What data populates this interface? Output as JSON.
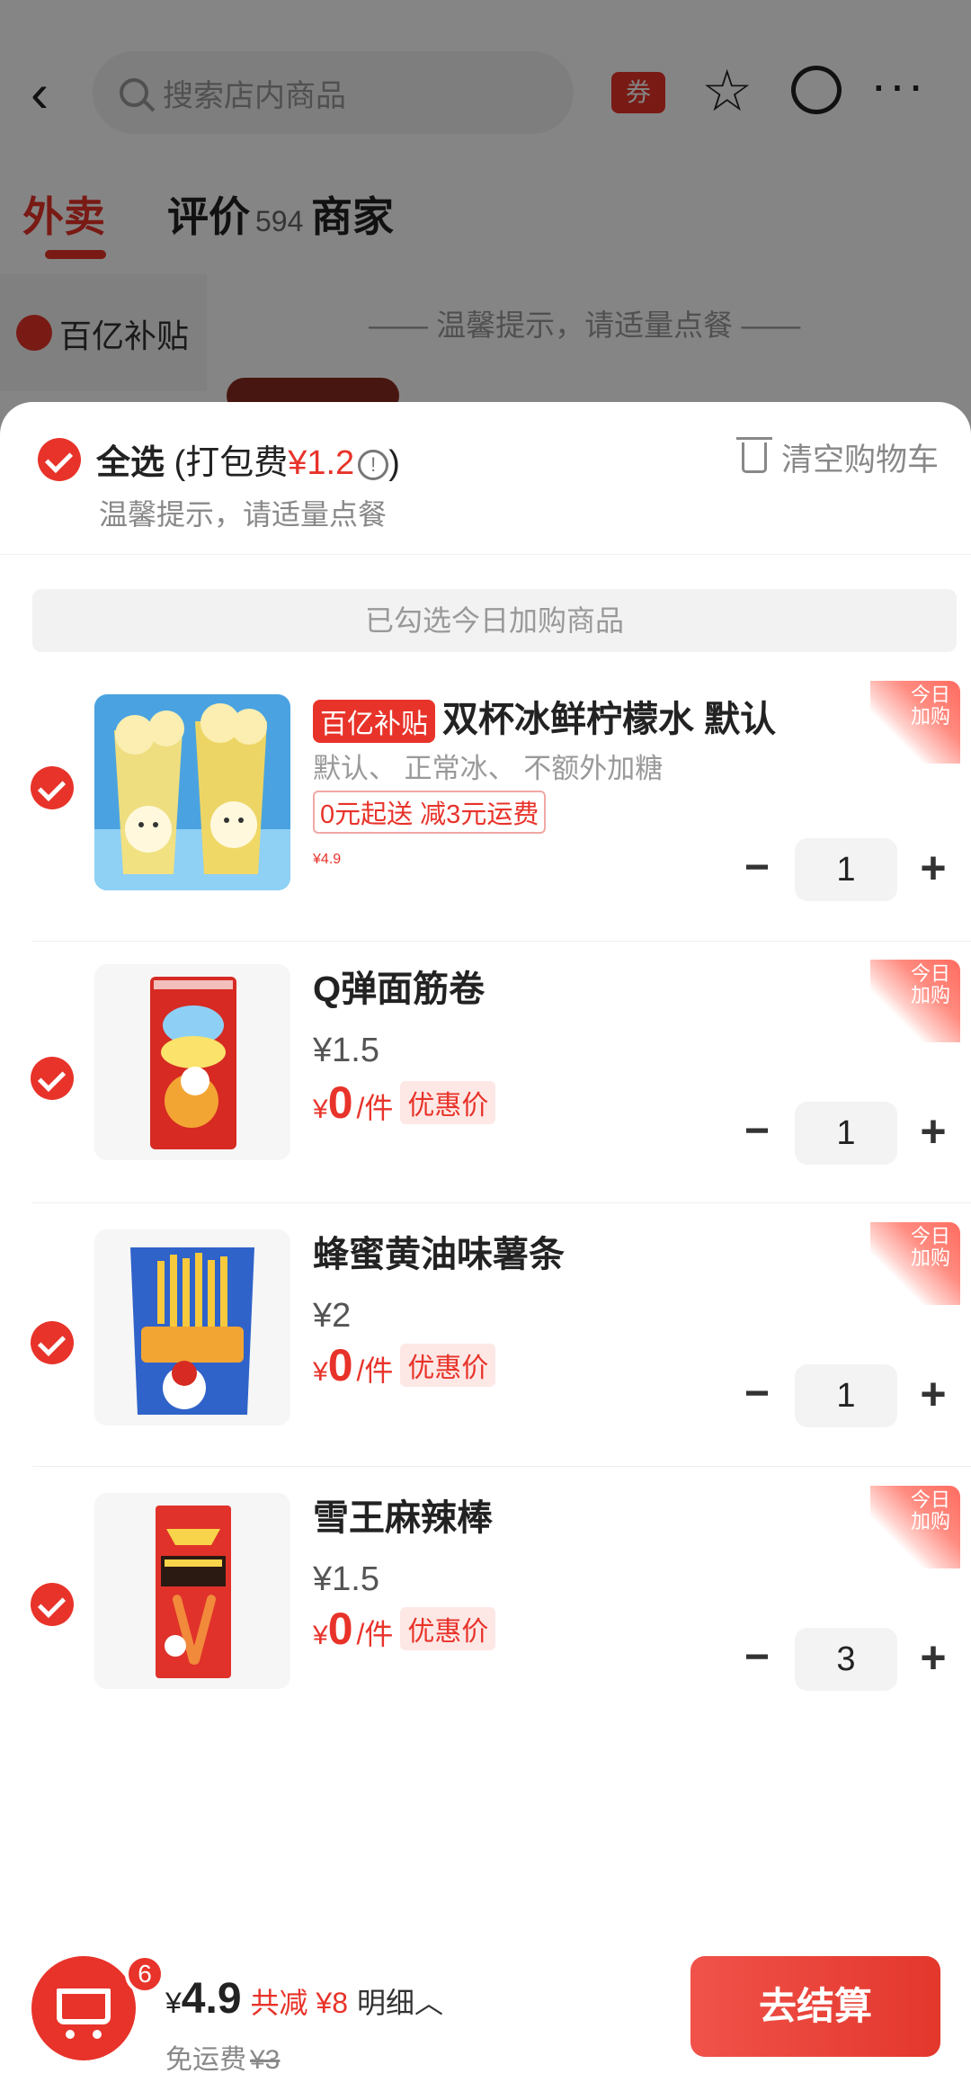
{
  "header": {
    "search_placeholder": "搜索店内商品",
    "coupon_label": "券"
  },
  "tabs": [
    {
      "label": "外卖",
      "count": ""
    },
    {
      "label": "评价",
      "count": "594"
    },
    {
      "label": "商家",
      "count": ""
    }
  ],
  "background": {
    "side_label": "百亿补贴",
    "tip": "—— 温馨提示，请适量点餐 ——"
  },
  "cart": {
    "select_all": "全选",
    "pack_fee_prefix": "(打包费",
    "pack_fee": "¥1.2",
    "pack_fee_suffix": ")",
    "info_mark": "!",
    "tip": "温馨提示，请适量点餐",
    "clear_label": "清空购物车",
    "section_label": "已勾选今日加购商品",
    "today_badge": "今日加购",
    "items": [
      {
        "tag": "百亿补贴",
        "name": "双杯冰鲜柠檬水 默认",
        "spec": "默认、 正常冰、 不额外加糖",
        "promo": "0元起送 减3元运费",
        "price_y": "¥",
        "price_int": "4",
        "price_dec": ".9",
        "qty": "1"
      },
      {
        "name": "Q弹面筋卷",
        "orig_price": "¥1.5",
        "price_y": "¥",
        "price_int": "0",
        "unit": "/件",
        "deal": "优惠价",
        "qty": "1"
      },
      {
        "name": "蜂蜜黄油味薯条",
        "orig_price": "¥2",
        "price_y": "¥",
        "price_int": "0",
        "unit": "/件",
        "deal": "优惠价",
        "qty": "1"
      },
      {
        "name": "雪王麻辣棒",
        "orig_price": "¥1.5",
        "price_y": "¥",
        "price_int": "0",
        "unit": "/件",
        "deal": "优惠价",
        "qty": "3"
      }
    ]
  },
  "bottom": {
    "cart_count": "6",
    "total_y": "¥",
    "total": "4.9",
    "save": "共减 ¥8",
    "detail": "明细︿",
    "delivery": "免运费",
    "delivery_orig": "¥3",
    "checkout": "去结算"
  },
  "colors": {
    "accent": "#e8332a"
  }
}
